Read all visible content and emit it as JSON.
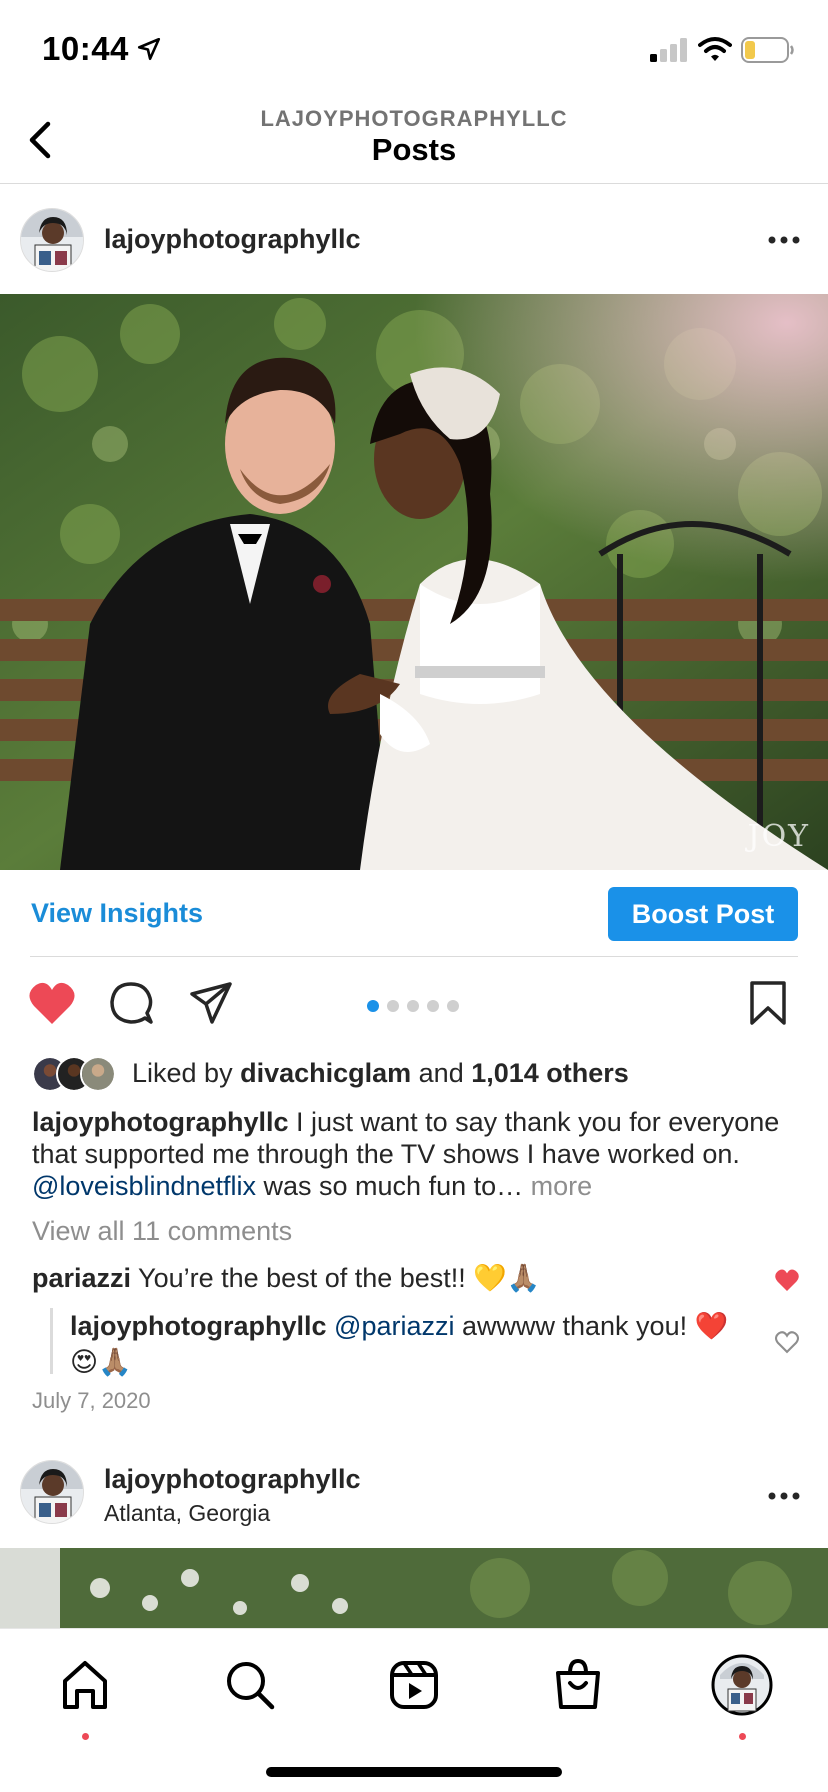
{
  "status_bar": {
    "time": "10:44",
    "icons": [
      "location-arrow-icon",
      "cell-signal-icon",
      "wifi-icon",
      "battery-low-icon"
    ]
  },
  "header": {
    "account": "LAJOYPHOTOGRAPHYLLC",
    "title": "Posts",
    "back_icon": "chevron-left-icon"
  },
  "post1": {
    "username": "lajoyphotographyllc",
    "more_icon": "more-horizontal-icon",
    "photo_watermark": "JOY",
    "view_insights": "View Insights",
    "boost_post": "Boost Post",
    "liked": true,
    "carousel": {
      "total": 5,
      "active": 1
    },
    "likes": {
      "prefix": "Liked by ",
      "user": "divachicglam",
      "middle": " and ",
      "others": "1,014 others"
    },
    "caption": {
      "username": "lajoyphotographyllc",
      "text_before": " I just want to say thank you for everyone that supported me through the TV shows I have worked on. ",
      "mention": "@loveisblindnetflix",
      "text_after": " was so much fun to…",
      "more": " more"
    },
    "view_comments": "View all 11 comments",
    "comment": {
      "username": "pariazzi",
      "text": " You’re the best of the best!! 💛🙏🏽"
    },
    "reply": {
      "username": "lajoyphotographyllc",
      "mention": " @pariazzi",
      "text": " awwww thank you! ❤️😍🙏🏽"
    },
    "date": "July 7, 2020"
  },
  "post2": {
    "username": "lajoyphotographyllc",
    "location": "Atlanta, Georgia"
  },
  "colors": {
    "link_blue": "#1a8cd8",
    "button_blue": "#1a91e8",
    "heart_red": "#ed4956",
    "mention": "#00376b",
    "muted": "#8e8e8e"
  },
  "tab_bar": {
    "tabs": [
      "home-icon",
      "search-icon",
      "reels-icon",
      "shop-icon",
      "profile-avatar"
    ]
  }
}
